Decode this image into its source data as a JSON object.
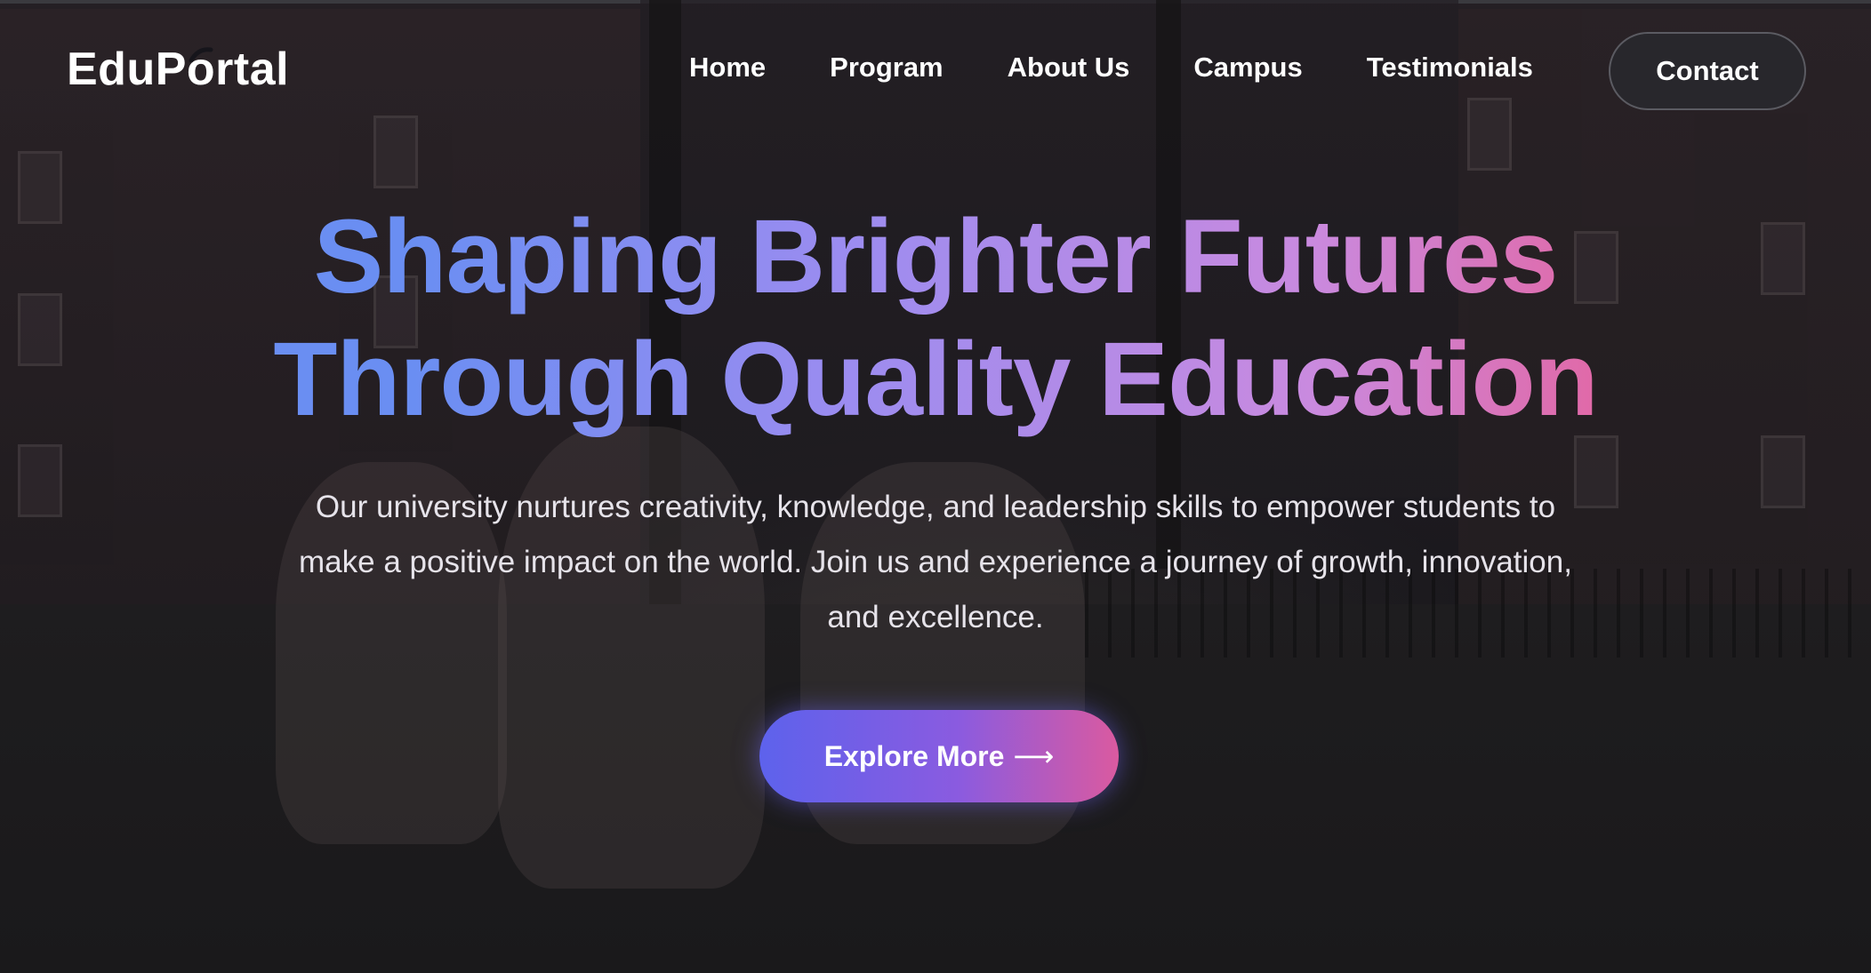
{
  "brand": {
    "logo_text_before": "EduP",
    "logo_text_after": "rtal",
    "logo_o_icon": "graduation-cap-icon"
  },
  "nav": {
    "items": [
      {
        "label": "Home"
      },
      {
        "label": "Program"
      },
      {
        "label": "About Us"
      },
      {
        "label": "Campus"
      },
      {
        "label": "Testimonials"
      }
    ],
    "contact_label": "Contact"
  },
  "hero": {
    "headline_line1": "Shaping Brighter Futures",
    "headline_line2": "Through Quality Education",
    "description": "Our university nurtures creativity, knowledge, and leadership skills to empower students to make a positive impact on the world. Join us and experience a journey of growth, innovation, and excellence.",
    "cta_label": "Explore More",
    "cta_icon": "arrow-right-icon",
    "cta_arrow": "⟶"
  },
  "colors": {
    "gradient_start": "#5d62ec",
    "gradient_end": "#da5aa0",
    "headline_blue": "#6a8ef2",
    "headline_pink": "#e06aa9"
  }
}
